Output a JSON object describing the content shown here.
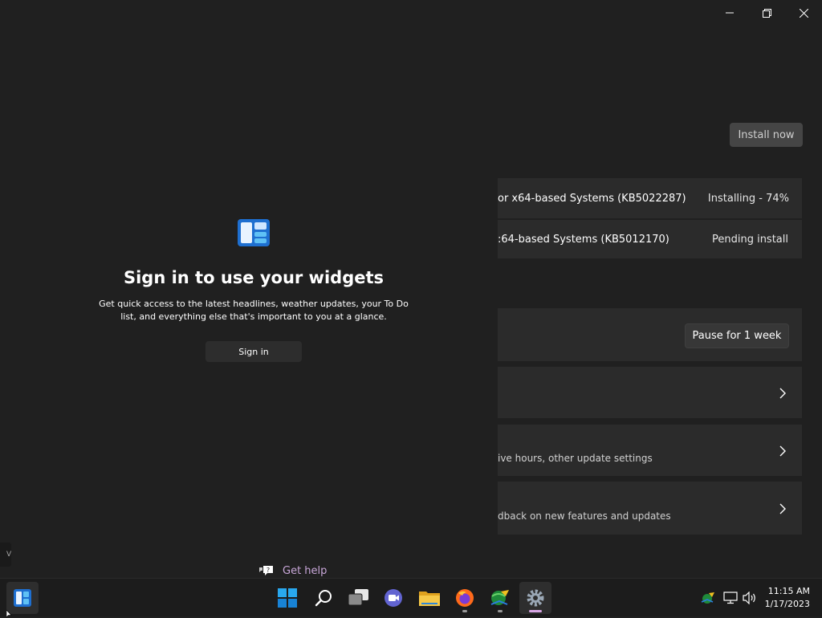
{
  "settings": {
    "install_button": "Install now",
    "updates": [
      {
        "name": "or x64-based Systems (KB5022287)",
        "status": "Installing - 74%"
      },
      {
        "name": ":64-based Systems (KB5012170)",
        "status": "Pending install"
      }
    ],
    "pause_button": "Pause for 1 week",
    "advanced_subtitle": "ive hours, other update settings",
    "insider_subtitle": "dback on new features and updates"
  },
  "widgets": {
    "title": "Sign in to use your widgets",
    "description": "Get quick access to the latest headlines, weather updates, your To Do list, and everything else that's important to you at a glance.",
    "sign_in_button": "Sign in"
  },
  "get_help": "Get help",
  "side_tab_label": "V",
  "taskbar": {
    "apps": [
      "widgets-icon",
      "start-icon",
      "search-icon",
      "task-view-icon",
      "teams-chat-icon",
      "file-explorer-icon",
      "firefox-icon",
      "network-app-icon",
      "settings-icon"
    ],
    "clock": {
      "time": "11:15 AM",
      "date": "1/17/2023"
    }
  },
  "colors": {
    "background": "#202020",
    "card": "#2b2b2b",
    "accent_indicator": "#d9a7e6",
    "help_link": "#c9a7d9"
  }
}
